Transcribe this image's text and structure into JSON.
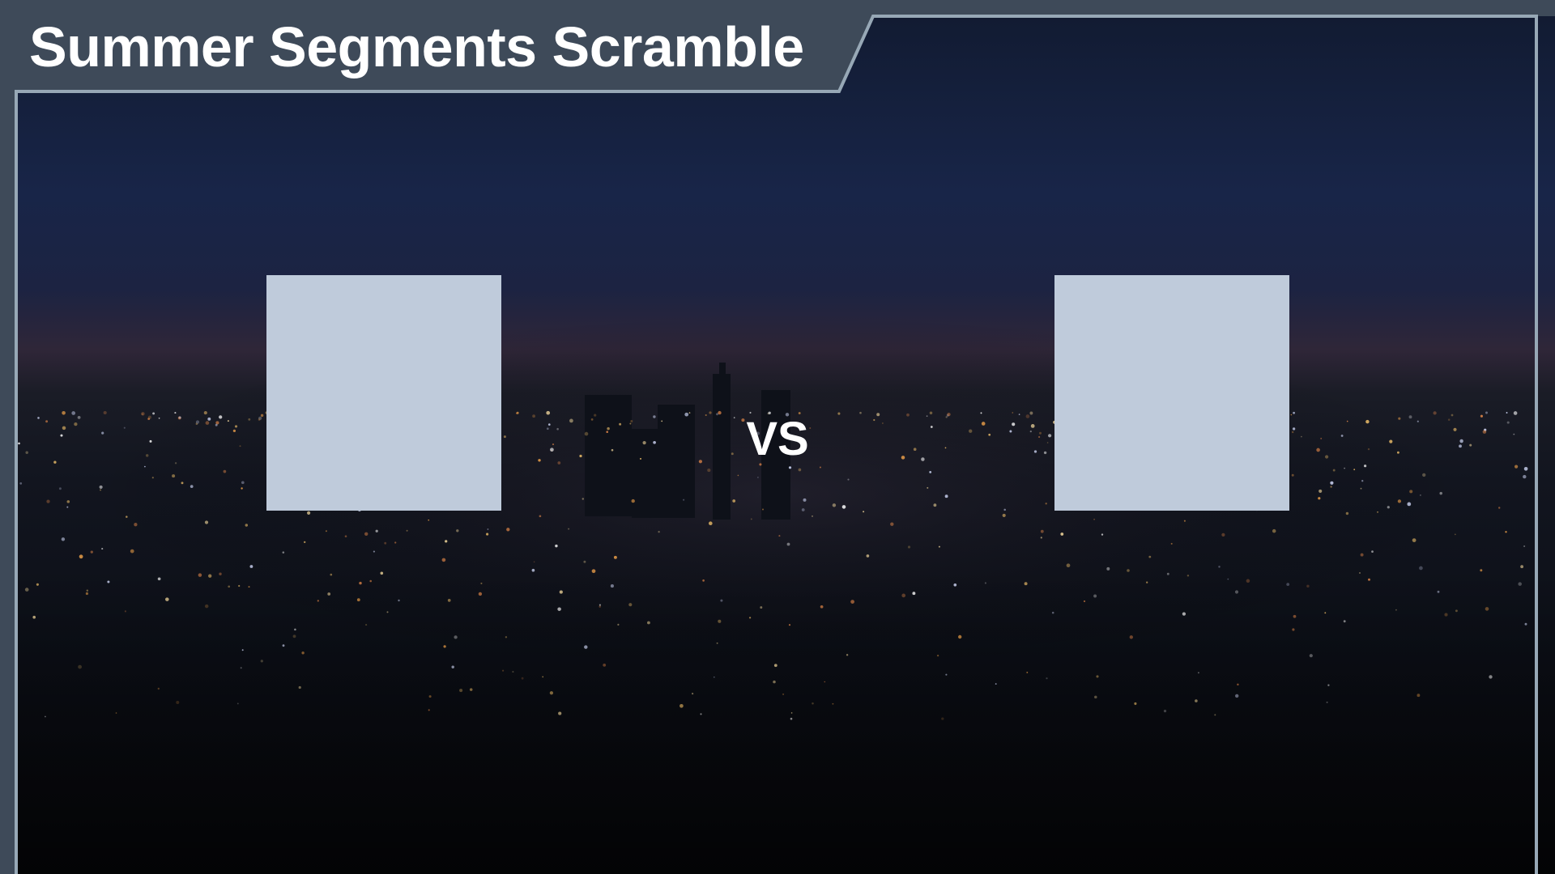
{
  "title": "Summer Segments Scramble",
  "versus_label": "VS",
  "colors": {
    "panel": "#3e4a59",
    "border": "#97a8b6",
    "slot": "#bfcbdb",
    "title_text": "#ffffff",
    "sky_top": "#182445",
    "ground": "#0b0d14"
  }
}
